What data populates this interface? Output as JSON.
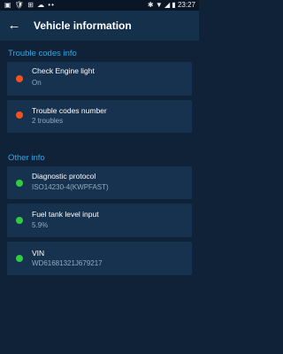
{
  "status_bar": {
    "left_icons": "▣ 🛡 ⊞ ☁ ••",
    "right_icons": "✱ ▼ ◢ ▮",
    "time": "23:27"
  },
  "app_bar": {
    "title": "Vehicle information",
    "back_icon": "arrow-back-icon"
  },
  "colors": {
    "accent": "#2ea7e6",
    "red_status": "#f4511e",
    "green_status": "#2ecc40"
  },
  "sections": {
    "trouble": {
      "header": "Trouble codes info",
      "items": [
        {
          "title": "Check Engine light",
          "value": "On",
          "status": "red"
        },
        {
          "title": "Trouble codes number",
          "value": "2 troubles",
          "status": "red"
        }
      ]
    },
    "other": {
      "header": "Other info",
      "items": [
        {
          "title": "Diagnostic protocol",
          "value": "ISO14230-4(KWPFAST)",
          "status": "green"
        },
        {
          "title": "Fuel tank level input",
          "value": "5.9%",
          "status": "green"
        },
        {
          "title": "VIN",
          "value": "WD61681321J679217",
          "status": "green"
        }
      ]
    }
  }
}
